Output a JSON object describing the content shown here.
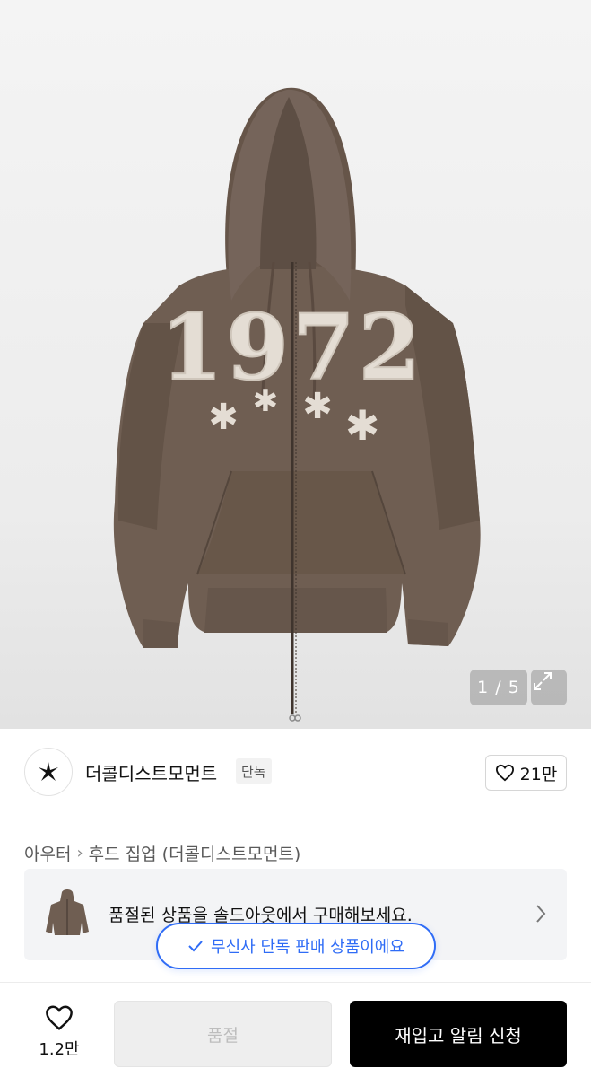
{
  "gallery": {
    "counter": "1 / 5",
    "print_text": "1972",
    "colors": {
      "hoodie": "#6f5e52",
      "hoodie_shadow": "#5d4e44",
      "patch": "#e4ddd4"
    }
  },
  "brand": {
    "name": "더콜디스트모먼트",
    "badge": "단독",
    "like_count": "21만"
  },
  "breadcrumb": {
    "parent": "아우터",
    "current": "후드 집업 (더콜디스트모먼트)"
  },
  "soldout_banner": {
    "text": "품절된 상품을 솔드아웃에서 구매해보세요."
  },
  "exclusive_toast": {
    "text": "무신사 단독 판매 상품이에요",
    "color": "#2f6cf6"
  },
  "bottom_bar": {
    "wish_count": "1.2만",
    "soldout_label": "품절",
    "restock_label": "재입고 알림 신청"
  }
}
